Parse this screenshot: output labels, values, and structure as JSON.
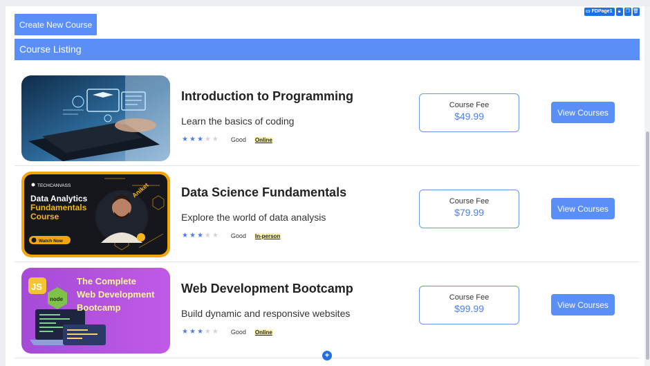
{
  "toolbar": {
    "create_label": "Create New Course",
    "page_tag": "FDPage1"
  },
  "listing": {
    "header": "Course Listing"
  },
  "courses": [
    {
      "title": "Introduction to Programming",
      "description": "Learn the basics of coding",
      "rating_stars": 3,
      "rating_max": 5,
      "rating_label": "Good",
      "mode": "Online",
      "fee_label": "Course Fee",
      "fee": "$49.99",
      "button": "View Courses"
    },
    {
      "title": "Data Science Fundamentals",
      "description": "Explore the world of data analysis",
      "rating_stars": 3,
      "rating_max": 5,
      "rating_label": "Good",
      "mode": "In-person",
      "fee_label": "Course Fee",
      "fee": "$79.99",
      "button": "View Courses",
      "thumb_text": {
        "brand": "TECHCANVASS",
        "line1": "Data Analytics",
        "line2": "Fundamentals",
        "line3": "Course",
        "name": "Aniket",
        "cta": "Watch Now"
      }
    },
    {
      "title": "Web Development Bootcamp",
      "description": "Build dynamic and responsive websites",
      "rating_stars": 3,
      "rating_max": 5,
      "rating_label": "Good",
      "mode": "Online",
      "fee_label": "Course Fee",
      "fee": "$99.99",
      "button": "View Courses",
      "thumb_text": {
        "badge1": "JS",
        "badge2": "node",
        "line1": "The Complete",
        "line2": "Web Development",
        "line3": "Bootcamp"
      }
    }
  ],
  "colors": {
    "accent": "#5b8ff8",
    "price": "#4f7fe6",
    "mode_highlight": "#fdf6b3"
  }
}
